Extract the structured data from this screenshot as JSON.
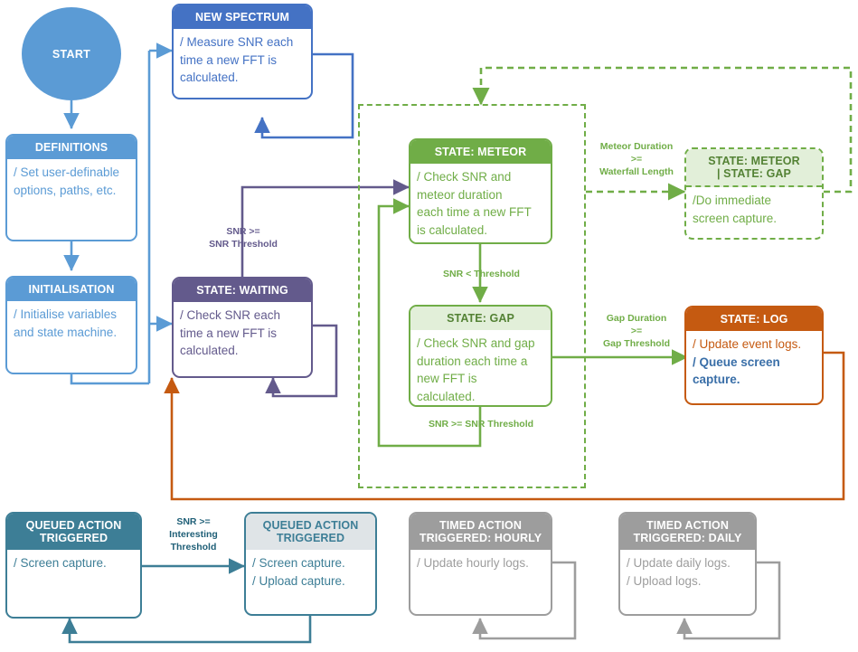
{
  "diagram": {
    "title": "Meteor detection state machine flowchart",
    "colors": {
      "blue": "#5b9bd5",
      "royal_blue": "#4472c4",
      "purple": "#635a8c",
      "green": "#70ad47",
      "green_light_fill": "#e2efd9",
      "green_dark_text": "#548235",
      "orange": "#c55a11",
      "teal": "#3d7e96",
      "teal_light_fill": "#dfe4e7",
      "grey": "#9d9d9d",
      "log_blue_text": "#3a6fa8"
    },
    "nodes": {
      "start": {
        "label": "START",
        "shape": "circle",
        "color": "blue"
      },
      "definitions": {
        "header": "DEFINITIONS",
        "body": [
          "/ Set user-definable",
          "options, paths, etc."
        ],
        "color": "blue"
      },
      "initialisation": {
        "header": "INITIALISATION",
        "body": [
          "/ Initialise variables",
          "and state machine."
        ],
        "color": "blue"
      },
      "new_spectrum": {
        "header": "NEW SPECTRUM",
        "body": [
          "/ Measure SNR each",
          "time a new FFT is",
          "calculated."
        ],
        "color": "royal_blue"
      },
      "state_waiting": {
        "header": "STATE: WAITING",
        "body": [
          "/ Check SNR each",
          "time a new FFT is",
          "calculated."
        ],
        "color": "purple"
      },
      "state_meteor": {
        "header": "STATE: METEOR",
        "body": [
          "/ Check SNR and",
          "meteor duration",
          "each time a new FFT",
          "is calculated."
        ],
        "color": "green"
      },
      "state_gap": {
        "header": "STATE: GAP",
        "body": [
          "/ Check SNR and gap",
          "duration each time a",
          "new FFT is",
          "calculated."
        ],
        "color": "green_light"
      },
      "state_meteor_or_gap": {
        "header_line1": "STATE: METEOR",
        "header_line2": "| STATE: GAP",
        "body": [
          "/Do immediate",
          "screen capture."
        ],
        "color": "green_dashed"
      },
      "state_log": {
        "header": "STATE: LOG",
        "body_line1": "/ Update event logs.",
        "body_line2": "/ Queue screen",
        "body_line3": "capture.",
        "color": "orange"
      },
      "queued_action_triggered_1": {
        "header_line1": "QUEUED ACTION",
        "header_line2": "TRIGGERED",
        "body": [
          "/ Screen capture."
        ],
        "color": "teal"
      },
      "queued_action_triggered_2": {
        "header_line1": "QUEUED ACTION",
        "header_line2": "TRIGGERED",
        "body": [
          "/ Screen capture.",
          "/ Upload capture."
        ],
        "color": "teal_light"
      },
      "timed_action_hourly": {
        "header_line1": "TIMED ACTION",
        "header_line2": "TRIGGERED: HOURLY",
        "body": [
          "/ Update hourly logs."
        ],
        "color": "grey"
      },
      "timed_action_daily": {
        "header_line1": "TIMED ACTION",
        "header_line2": "TRIGGERED: DAILY",
        "body": [
          "/ Update daily logs.",
          "/ Upload logs."
        ],
        "color": "grey"
      }
    },
    "edge_labels": {
      "snr_ge_threshold": "SNR >=\nSNR Threshold",
      "snr_lt_threshold": "SNR < Threshold",
      "snr_ge_snr_threshold": "SNR >= SNR Threshold",
      "meteor_duration": "Meteor Duration\n>=\nWaterfall Length",
      "gap_duration": "Gap Duration\n>=\nGap Threshold",
      "snr_ge_interesting": "SNR >=\nInteresting\nThreshold"
    }
  }
}
